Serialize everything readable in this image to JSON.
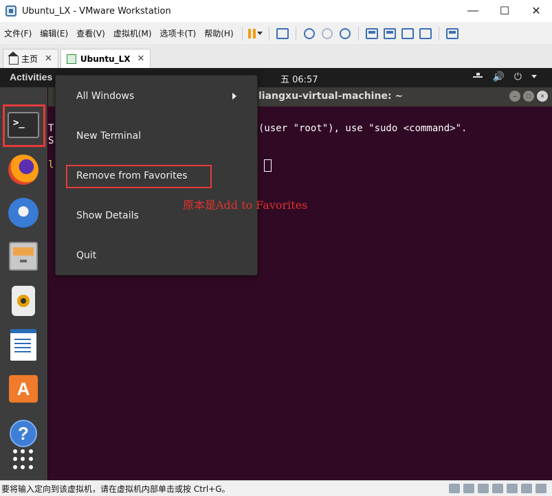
{
  "window": {
    "title": "Ubuntu_LX - VMware Workstation",
    "minimize_glyph": "—",
    "maximize_glyph": "☐",
    "close_glyph": "✕"
  },
  "menu": {
    "items": [
      "文件(F)",
      "编辑(E)",
      "查看(V)",
      "虚拟机(M)",
      "选项卡(T)",
      "帮助(H)"
    ]
  },
  "toolbar": {
    "icons": [
      "pause-icon",
      "send-ctrl-alt-del-icon",
      "snapshot-icon",
      "revert-snapshot-icon",
      "snapshot-manager-icon",
      "library-icon",
      "full-screen-icon",
      "unity-icon",
      "stretch-icon",
      "console-view-icon",
      "thumbnail-icon"
    ],
    "pause_color": "#f29d0f",
    "accent": "#3b6fb5"
  },
  "tabs": [
    {
      "label": "主页",
      "close": "✕"
    },
    {
      "label": "Ubuntu_LX",
      "close": "✕"
    }
  ],
  "ubuntu": {
    "activities": "Activities",
    "clock": "五 06:57",
    "volume_glyph": "🔊",
    "power_glyph": "⏻",
    "background": "#2c001e",
    "panel_color": "#1d1d1d",
    "dock_color": "#3d3d3d",
    "dock_items": [
      "terminal-icon",
      "firefox-icon",
      "thunderbird-icon",
      "files-icon",
      "rhythmbox-icon",
      "libreoffice-writer-icon",
      "ubuntu-software-icon",
      "help-icon",
      "show-applications-icon"
    ],
    "terminal_glyph": ">_",
    "store_glyph": "A",
    "help_glyph": "?"
  },
  "terminal": {
    "title": "liangxu-virtual-machine: ~",
    "line1_prefix": "T",
    "line1_text": "(user \"root\"), use \"sudo <command>\".",
    "line2_prefix": "S",
    "line3_prefix": "l",
    "background": "#300a24"
  },
  "context_menu": {
    "items": [
      "All Windows",
      "New Terminal",
      "Remove from Favorites",
      "Show Details",
      "Quit"
    ],
    "highlight_color": "#e83a3a"
  },
  "annotation": {
    "text": "原本是Add to Favorites",
    "color": "#e0312f"
  },
  "statusbar": {
    "message": "要将输入定向到该虚拟机，请在虚拟机内部单击或按 Ctrl+G。"
  }
}
